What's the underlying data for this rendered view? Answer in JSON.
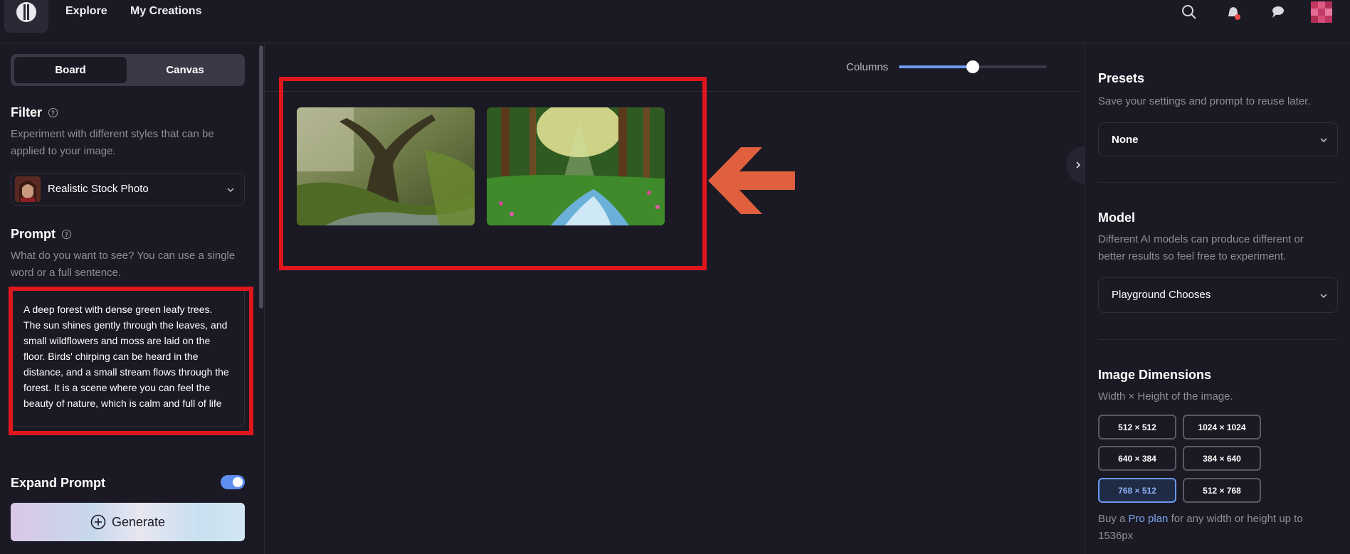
{
  "nav": {
    "explore": "Explore",
    "my_creations": "My Creations"
  },
  "icons": {
    "logo": "playground-logo-icon",
    "search": "search-icon",
    "notifications": "bell-icon",
    "chat": "chat-icon",
    "avatar": "avatar"
  },
  "left": {
    "tabs": [
      "Board",
      "Canvas"
    ],
    "filter": {
      "title": "Filter",
      "description": "Experiment with different styles that can be applied to your image.",
      "selected": "Realistic Stock Photo"
    },
    "prompt": {
      "title": "Prompt",
      "description": "What do you want to see? You can use a single word or a full sentence.",
      "value": "A deep forest with dense green leafy trees. The sun shines gently through the leaves, and small wildflowers and moss are laid on the floor. Birds' chirping can be heard in the distance, and a small stream flows through the forest. It is a scene where you can feel the beauty of nature, which is calm and full of life"
    },
    "expand_prompt": {
      "label": "Expand Prompt",
      "enabled": true
    },
    "generate_label": "Generate"
  },
  "center": {
    "columns_label": "Columns",
    "columns_slider_fraction": 0.5,
    "images": [
      "forest-image-1",
      "forest-image-2"
    ]
  },
  "right": {
    "presets": {
      "title": "Presets",
      "description": "Save your settings and prompt to reuse later.",
      "selected": "None"
    },
    "model": {
      "title": "Model",
      "description": "Different AI models can produce different or better results so feel free to experiment.",
      "selected": "Playground Chooses"
    },
    "dimensions": {
      "title": "Image Dimensions",
      "description": "Width × Height of the image.",
      "options": [
        "512 × 512",
        "1024 × 1024",
        "640 × 384",
        "384 × 640",
        "768 × 512",
        "512 × 768"
      ],
      "selected": "768 × 512",
      "pro_prefix": "Buy a ",
      "pro_link": "Pro plan",
      "pro_suffix": " for any width or height up to 1536px"
    }
  },
  "colors": {
    "background": "#1b1a24",
    "accent": "#6b9af0",
    "highlight_box": "#e0161d",
    "arrow": "#e0603e"
  }
}
